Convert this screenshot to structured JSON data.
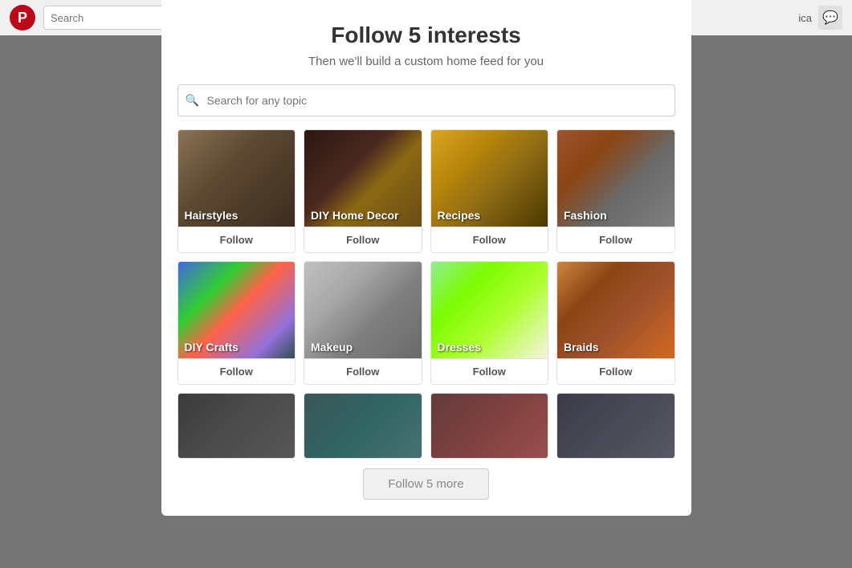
{
  "topbar": {
    "logo_letter": "P",
    "search_placeholder": "Search",
    "username": "ica",
    "message_icon": "💬"
  },
  "modal": {
    "title": "Follow 5 interests",
    "subtitle": "Then we'll build a custom home feed for you",
    "search_placeholder": "Search for any topic"
  },
  "interests": [
    {
      "id": "hairstyles",
      "label": "Hairstyles",
      "follow_label": "Follow",
      "img_class": "img-hairstyles"
    },
    {
      "id": "diy-home-decor",
      "label": "DIY Home Decor",
      "follow_label": "Follow",
      "img_class": "img-diy-home"
    },
    {
      "id": "recipes",
      "label": "Recipes",
      "follow_label": "Follow",
      "img_class": "img-recipes"
    },
    {
      "id": "fashion",
      "label": "Fashion",
      "follow_label": "Follow",
      "img_class": "img-fashion"
    },
    {
      "id": "diy-crafts",
      "label": "DIY Crafts",
      "follow_label": "Follow",
      "img_class": "img-diy-crafts"
    },
    {
      "id": "makeup",
      "label": "Makeup",
      "follow_label": "Follow",
      "img_class": "img-makeup"
    },
    {
      "id": "dresses",
      "label": "Dresses",
      "follow_label": "Follow",
      "img_class": "img-dresses"
    },
    {
      "id": "braids",
      "label": "Braids",
      "follow_label": "Follow",
      "img_class": "img-braids"
    }
  ],
  "bottom_cards": [
    {
      "id": "bottom1",
      "img_class": "img-bottom1"
    },
    {
      "id": "bottom2",
      "img_class": "img-bottom2"
    },
    {
      "id": "bottom3",
      "img_class": "img-bottom3"
    },
    {
      "id": "bottom4",
      "img_class": "img-bottom4"
    }
  ],
  "follow_more_label": "Follow 5 more"
}
